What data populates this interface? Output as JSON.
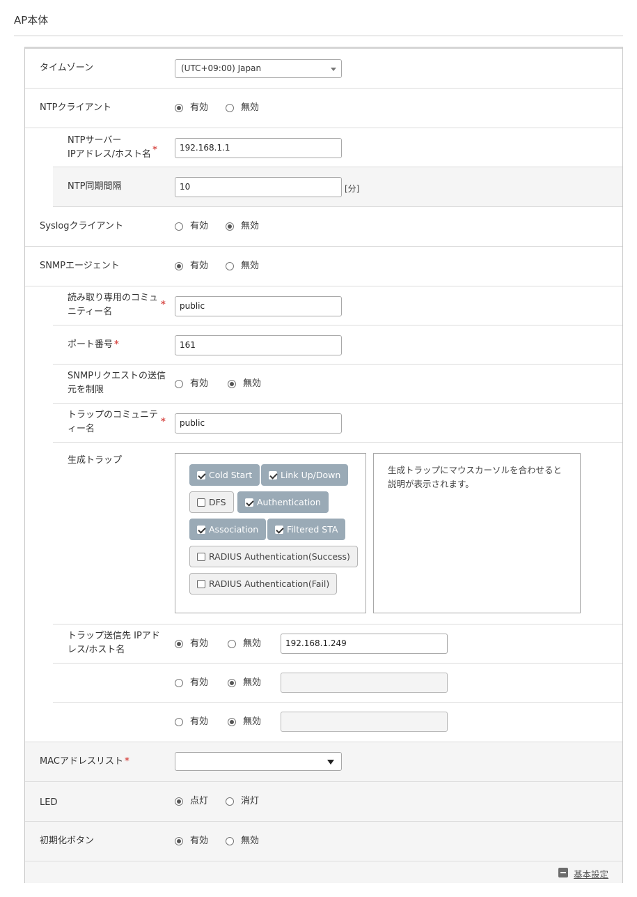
{
  "page_title": "AP本体",
  "timezone": {
    "label": "タイムゾーン",
    "value": "(UTC+09:00) Japan"
  },
  "ntp_client": {
    "label": "NTPクライアント",
    "options": [
      {
        "label": "有効",
        "selected": true
      },
      {
        "label": "無効",
        "selected": false
      }
    ],
    "server": {
      "label_line1": "NTPサーバー",
      "label_line2": "IPアドレス/ホスト名",
      "required_mark": "*",
      "value": "192.168.1.1"
    },
    "interval": {
      "label": "NTP同期間隔",
      "value": "10",
      "unit": "[分]"
    }
  },
  "syslog_client": {
    "label": "Syslogクライアント",
    "options": [
      {
        "label": "有効",
        "selected": false
      },
      {
        "label": "無効",
        "selected": true
      }
    ]
  },
  "snmp_agent": {
    "label": "SNMPエージェント",
    "options": [
      {
        "label": "有効",
        "selected": true
      },
      {
        "label": "無効",
        "selected": false
      }
    ],
    "ro_community": {
      "label_line1": "読み取り専用のコミュ",
      "label_line2": "ニティー名",
      "required_mark": "*",
      "value": "public"
    },
    "port": {
      "label": "ポート番号",
      "required_mark": "*",
      "value": "161"
    },
    "restrict_source": {
      "label_line1": "SNMPリクエストの送信",
      "label_line2": "元を制限",
      "options": [
        {
          "label": "有効",
          "selected": false
        },
        {
          "label": "無効",
          "selected": true
        }
      ]
    },
    "trap_community": {
      "label_line1": "トラップのコミュニテ",
      "label_line2": "ィー名",
      "required_mark": "*",
      "value": "public"
    },
    "generated_traps": {
      "label": "生成トラップ",
      "items": [
        {
          "label": "Cold Start",
          "checked": true
        },
        {
          "label": "Link Up/Down",
          "checked": true
        },
        {
          "label": "DFS",
          "checked": false
        },
        {
          "label": "Authentication",
          "checked": true
        },
        {
          "label": "Association",
          "checked": true
        },
        {
          "label": "Filtered STA",
          "checked": true
        },
        {
          "label": "RADIUS Authentication(Success)",
          "checked": false
        },
        {
          "label": "RADIUS Authentication(Fail)",
          "checked": false
        }
      ],
      "description": "生成トラップにマウスカーソルを合わせると説明が表示されます。"
    },
    "trap_destinations": {
      "label_line1": "トラップ送信先 IPアド",
      "label_line2": "レス/ホスト名",
      "rows": [
        {
          "enable_label": "有効",
          "disable_label": "無効",
          "enabled": true,
          "value": "192.168.1.249"
        },
        {
          "enable_label": "有効",
          "disable_label": "無効",
          "enabled": false,
          "value": ""
        },
        {
          "enable_label": "有効",
          "disable_label": "無効",
          "enabled": false,
          "value": ""
        }
      ]
    }
  },
  "mac_address_list": {
    "label": "MACアドレスリスト",
    "required_mark": "*",
    "value": ""
  },
  "led": {
    "label": "LED",
    "options": [
      {
        "label": "点灯",
        "selected": true
      },
      {
        "label": "消灯",
        "selected": false
      }
    ]
  },
  "init_button": {
    "label": "初期化ボタン",
    "options": [
      {
        "label": "有効",
        "selected": true
      },
      {
        "label": "無効",
        "selected": false
      }
    ]
  },
  "footer": {
    "link_label": "基本設定",
    "icon": "minus-square-icon"
  }
}
